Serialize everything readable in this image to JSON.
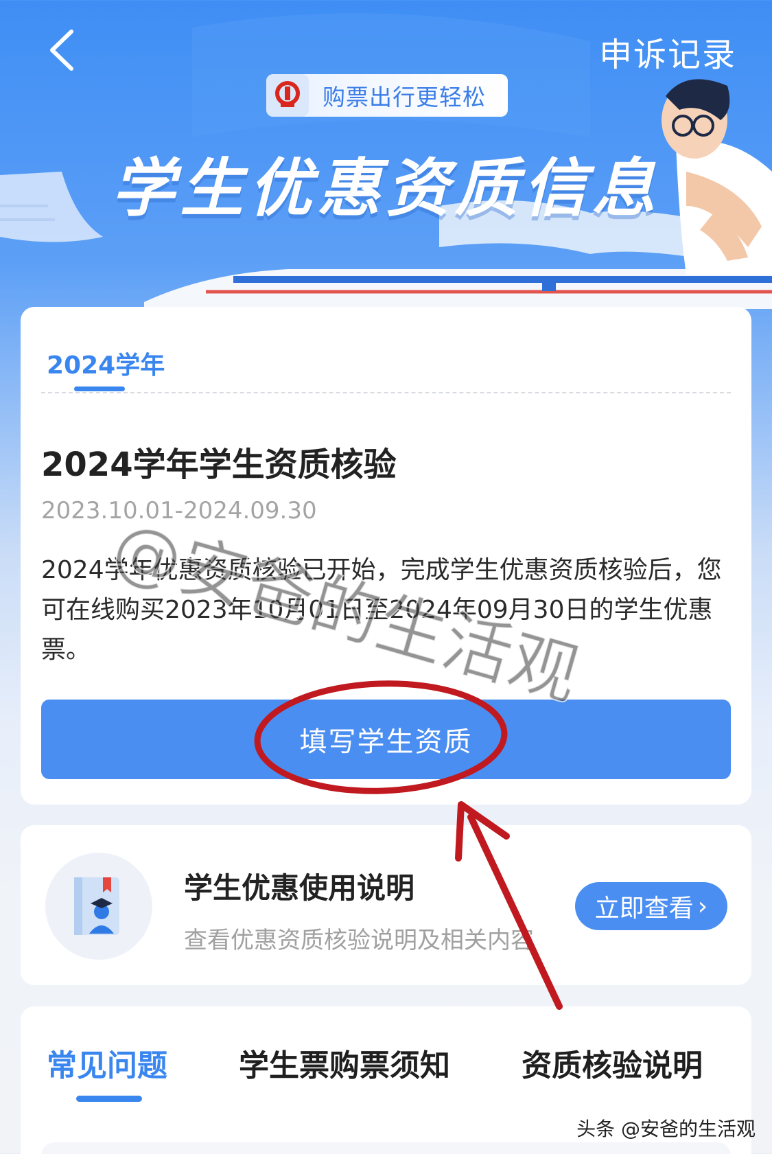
{
  "header": {
    "appeal_link": "申诉记录",
    "brand_slogan": "购票出行更轻松",
    "hero_title": "学生优惠资质信息"
  },
  "main_card": {
    "year_tab": "2024学年",
    "title": "2024学年学生资质核验",
    "date_range": "2023.10.01-2024.09.30",
    "description": "2024学年优惠资质核验已开始，完成学生优惠资质核验后，您可在线购买2023年10月01日至2024年09月30日的学生优惠票。",
    "fill_button": "填写学生资质"
  },
  "info_card": {
    "title": "学生优惠使用说明",
    "subtitle": "查看优惠资质核验说明及相关内容",
    "view_button": "立即查看",
    "view_chevron": "›"
  },
  "faq_tabs": [
    {
      "label": "常见问题",
      "active": true
    },
    {
      "label": "学生票购票须知",
      "active": false
    },
    {
      "label": "资质核验说明",
      "active": false
    }
  ],
  "overlay": {
    "watermark": "@安爸的生活观",
    "source_credit": "头条 @安爸的生活观",
    "annotation_color": "#c0191f"
  },
  "colors": {
    "primary": "#4a8ef2",
    "accent_text": "#3a86ef",
    "hero_blue": "#3f8ef5"
  }
}
